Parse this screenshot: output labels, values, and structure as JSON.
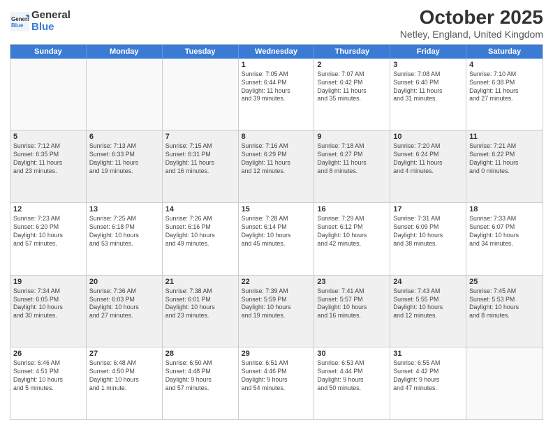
{
  "logo": {
    "general": "General",
    "blue": "Blue"
  },
  "title": "October 2025",
  "subtitle": "Netley, England, United Kingdom",
  "days": [
    "Sunday",
    "Monday",
    "Tuesday",
    "Wednesday",
    "Thursday",
    "Friday",
    "Saturday"
  ],
  "rows": [
    [
      {
        "day": "",
        "text": ""
      },
      {
        "day": "",
        "text": ""
      },
      {
        "day": "",
        "text": ""
      },
      {
        "day": "1",
        "text": "Sunrise: 7:05 AM\nSunset: 6:44 PM\nDaylight: 11 hours\nand 39 minutes."
      },
      {
        "day": "2",
        "text": "Sunrise: 7:07 AM\nSunset: 6:42 PM\nDaylight: 11 hours\nand 35 minutes."
      },
      {
        "day": "3",
        "text": "Sunrise: 7:08 AM\nSunset: 6:40 PM\nDaylight: 11 hours\nand 31 minutes."
      },
      {
        "day": "4",
        "text": "Sunrise: 7:10 AM\nSunset: 6:38 PM\nDaylight: 11 hours\nand 27 minutes."
      }
    ],
    [
      {
        "day": "5",
        "text": "Sunrise: 7:12 AM\nSunset: 6:35 PM\nDaylight: 11 hours\nand 23 minutes."
      },
      {
        "day": "6",
        "text": "Sunrise: 7:13 AM\nSunset: 6:33 PM\nDaylight: 11 hours\nand 19 minutes."
      },
      {
        "day": "7",
        "text": "Sunrise: 7:15 AM\nSunset: 6:31 PM\nDaylight: 11 hours\nand 16 minutes."
      },
      {
        "day": "8",
        "text": "Sunrise: 7:16 AM\nSunset: 6:29 PM\nDaylight: 11 hours\nand 12 minutes."
      },
      {
        "day": "9",
        "text": "Sunrise: 7:18 AM\nSunset: 6:27 PM\nDaylight: 11 hours\nand 8 minutes."
      },
      {
        "day": "10",
        "text": "Sunrise: 7:20 AM\nSunset: 6:24 PM\nDaylight: 11 hours\nand 4 minutes."
      },
      {
        "day": "11",
        "text": "Sunrise: 7:21 AM\nSunset: 6:22 PM\nDaylight: 11 hours\nand 0 minutes."
      }
    ],
    [
      {
        "day": "12",
        "text": "Sunrise: 7:23 AM\nSunset: 6:20 PM\nDaylight: 10 hours\nand 57 minutes."
      },
      {
        "day": "13",
        "text": "Sunrise: 7:25 AM\nSunset: 6:18 PM\nDaylight: 10 hours\nand 53 minutes."
      },
      {
        "day": "14",
        "text": "Sunrise: 7:26 AM\nSunset: 6:16 PM\nDaylight: 10 hours\nand 49 minutes."
      },
      {
        "day": "15",
        "text": "Sunrise: 7:28 AM\nSunset: 6:14 PM\nDaylight: 10 hours\nand 45 minutes."
      },
      {
        "day": "16",
        "text": "Sunrise: 7:29 AM\nSunset: 6:12 PM\nDaylight: 10 hours\nand 42 minutes."
      },
      {
        "day": "17",
        "text": "Sunrise: 7:31 AM\nSunset: 6:09 PM\nDaylight: 10 hours\nand 38 minutes."
      },
      {
        "day": "18",
        "text": "Sunrise: 7:33 AM\nSunset: 6:07 PM\nDaylight: 10 hours\nand 34 minutes."
      }
    ],
    [
      {
        "day": "19",
        "text": "Sunrise: 7:34 AM\nSunset: 6:05 PM\nDaylight: 10 hours\nand 30 minutes."
      },
      {
        "day": "20",
        "text": "Sunrise: 7:36 AM\nSunset: 6:03 PM\nDaylight: 10 hours\nand 27 minutes."
      },
      {
        "day": "21",
        "text": "Sunrise: 7:38 AM\nSunset: 6:01 PM\nDaylight: 10 hours\nand 23 minutes."
      },
      {
        "day": "22",
        "text": "Sunrise: 7:39 AM\nSunset: 5:59 PM\nDaylight: 10 hours\nand 19 minutes."
      },
      {
        "day": "23",
        "text": "Sunrise: 7:41 AM\nSunset: 5:57 PM\nDaylight: 10 hours\nand 16 minutes."
      },
      {
        "day": "24",
        "text": "Sunrise: 7:43 AM\nSunset: 5:55 PM\nDaylight: 10 hours\nand 12 minutes."
      },
      {
        "day": "25",
        "text": "Sunrise: 7:45 AM\nSunset: 5:53 PM\nDaylight: 10 hours\nand 8 minutes."
      }
    ],
    [
      {
        "day": "26",
        "text": "Sunrise: 6:46 AM\nSunset: 4:51 PM\nDaylight: 10 hours\nand 5 minutes."
      },
      {
        "day": "27",
        "text": "Sunrise: 6:48 AM\nSunset: 4:50 PM\nDaylight: 10 hours\nand 1 minute."
      },
      {
        "day": "28",
        "text": "Sunrise: 6:50 AM\nSunset: 4:48 PM\nDaylight: 9 hours\nand 57 minutes."
      },
      {
        "day": "29",
        "text": "Sunrise: 6:51 AM\nSunset: 4:46 PM\nDaylight: 9 hours\nand 54 minutes."
      },
      {
        "day": "30",
        "text": "Sunrise: 6:53 AM\nSunset: 4:44 PM\nDaylight: 9 hours\nand 50 minutes."
      },
      {
        "day": "31",
        "text": "Sunrise: 6:55 AM\nSunset: 4:42 PM\nDaylight: 9 hours\nand 47 minutes."
      },
      {
        "day": "",
        "text": ""
      }
    ]
  ]
}
